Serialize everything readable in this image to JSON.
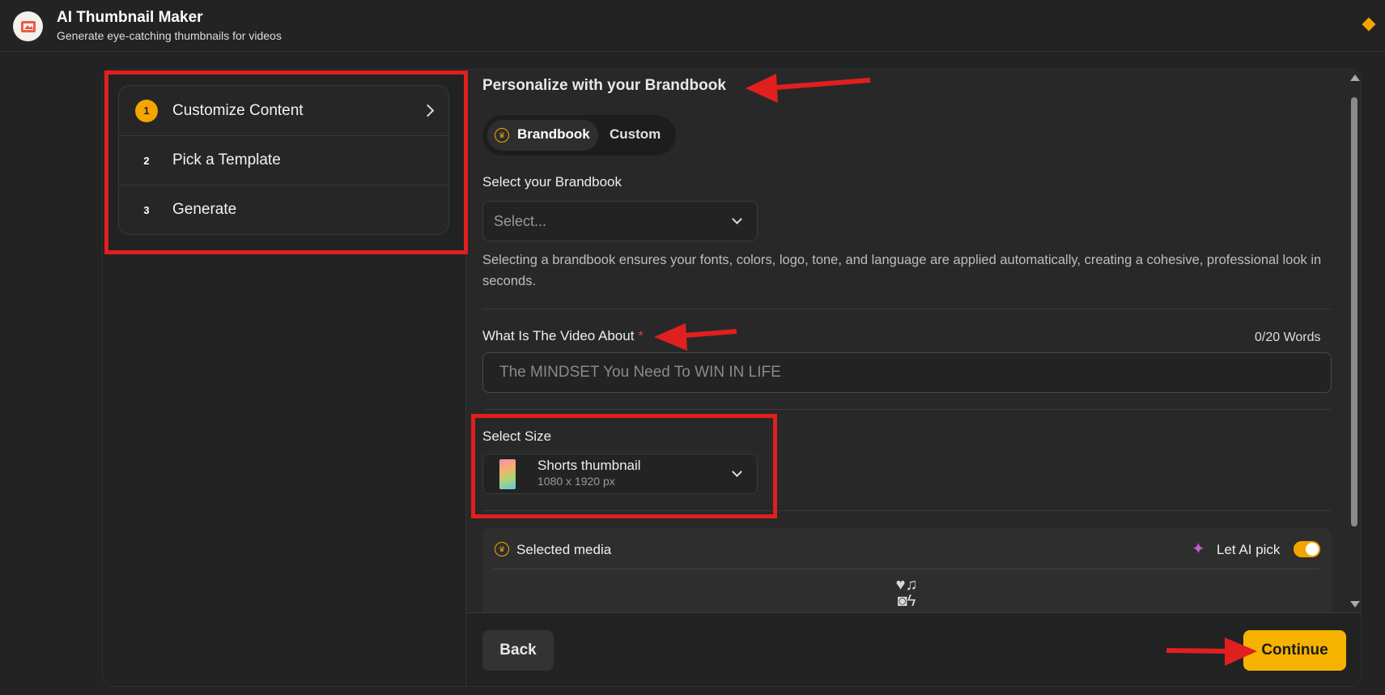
{
  "header": {
    "title": "AI Thumbnail Maker",
    "subtitle": "Generate eye-catching thumbnails for videos"
  },
  "steps": [
    {
      "number": "1",
      "label": "Customize Content",
      "active": true
    },
    {
      "number": "2",
      "label": "Pick a Template",
      "active": false
    },
    {
      "number": "3",
      "label": "Generate",
      "active": false
    }
  ],
  "brandbook": {
    "section_title": "Personalize with your Brandbook",
    "tabs": [
      "Brandbook",
      "Custom"
    ],
    "selected_tab": "Brandbook",
    "select_label": "Select your Brandbook",
    "select_placeholder": "Select...",
    "help_text": "Selecting a brandbook ensures your fonts, colors, logo, tone, and language are applied automatically, creating a cohesive, professional look in seconds."
  },
  "video_about": {
    "label": "What Is The Video About",
    "required_mark": "*",
    "counter": "0/20 Words",
    "placeholder": "The MINDSET You Need To WIN IN LIFE",
    "value": ""
  },
  "size": {
    "label": "Select Size",
    "selected_name": "Shorts thumbnail",
    "selected_dimensions": "1080 x 1920 px"
  },
  "media": {
    "label": "Selected media",
    "ai_label": "Let AI pick",
    "ai_enabled": true
  },
  "footer": {
    "back_label": "Back",
    "continue_label": "Continue"
  },
  "colors": {
    "accent": "#f5a500",
    "annotation": "#e01f1f",
    "background": "#232323"
  },
  "icons": [
    "logo-icon",
    "chevron-right-icon",
    "brandbook-badge-icon",
    "chevron-down-icon",
    "sparkle-icon",
    "media-types-icon"
  ]
}
